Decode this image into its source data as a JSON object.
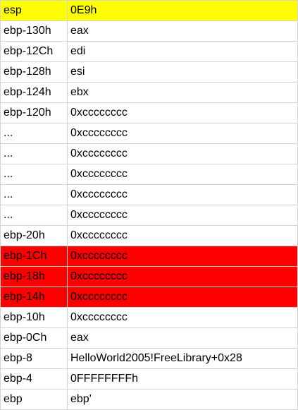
{
  "colors": {
    "yellow_highlight": "#FFFF00",
    "red_highlight": "#FF0000",
    "grid_line": "#D4D4D4"
  },
  "rows": [
    {
      "addr": "esp",
      "value": "0E9h",
      "highlight": "yellow"
    },
    {
      "addr": "ebp-130h",
      "value": "eax",
      "highlight": ""
    },
    {
      "addr": "ebp-12Ch",
      "value": "edi",
      "highlight": ""
    },
    {
      "addr": "ebp-128h",
      "value": "esi",
      "highlight": ""
    },
    {
      "addr": "ebp-124h",
      "value": "ebx",
      "highlight": ""
    },
    {
      "addr": "ebp-120h",
      "value": "0xcccccccc",
      "highlight": ""
    },
    {
      "addr": "...",
      "value": "0xcccccccc",
      "highlight": ""
    },
    {
      "addr": "...",
      "value": "0xcccccccc",
      "highlight": ""
    },
    {
      "addr": "...",
      "value": "0xcccccccc",
      "highlight": ""
    },
    {
      "addr": "...",
      "value": "0xcccccccc",
      "highlight": ""
    },
    {
      "addr": "...",
      "value": "0xcccccccc",
      "highlight": ""
    },
    {
      "addr": "ebp-20h",
      "value": "0xcccccccc",
      "highlight": ""
    },
    {
      "addr": "ebp-1Ch",
      "value": "0xcccccccc",
      "highlight": "red"
    },
    {
      "addr": "ebp-18h",
      "value": "0xcccccccc",
      "highlight": "red"
    },
    {
      "addr": "ebp-14h",
      "value": "0xcccccccc",
      "highlight": "red"
    },
    {
      "addr": "ebp-10h",
      "value": "0xcccccccc",
      "highlight": ""
    },
    {
      "addr": "ebp-0Ch",
      "value": "eax",
      "highlight": ""
    },
    {
      "addr": "ebp-8",
      "value": "HelloWorld2005!FreeLibrary+0x28",
      "highlight": ""
    },
    {
      "addr": "ebp-4",
      "value": "0FFFFFFFFh",
      "highlight": ""
    },
    {
      "addr": "ebp",
      "value": "ebp'",
      "highlight": ""
    }
  ]
}
